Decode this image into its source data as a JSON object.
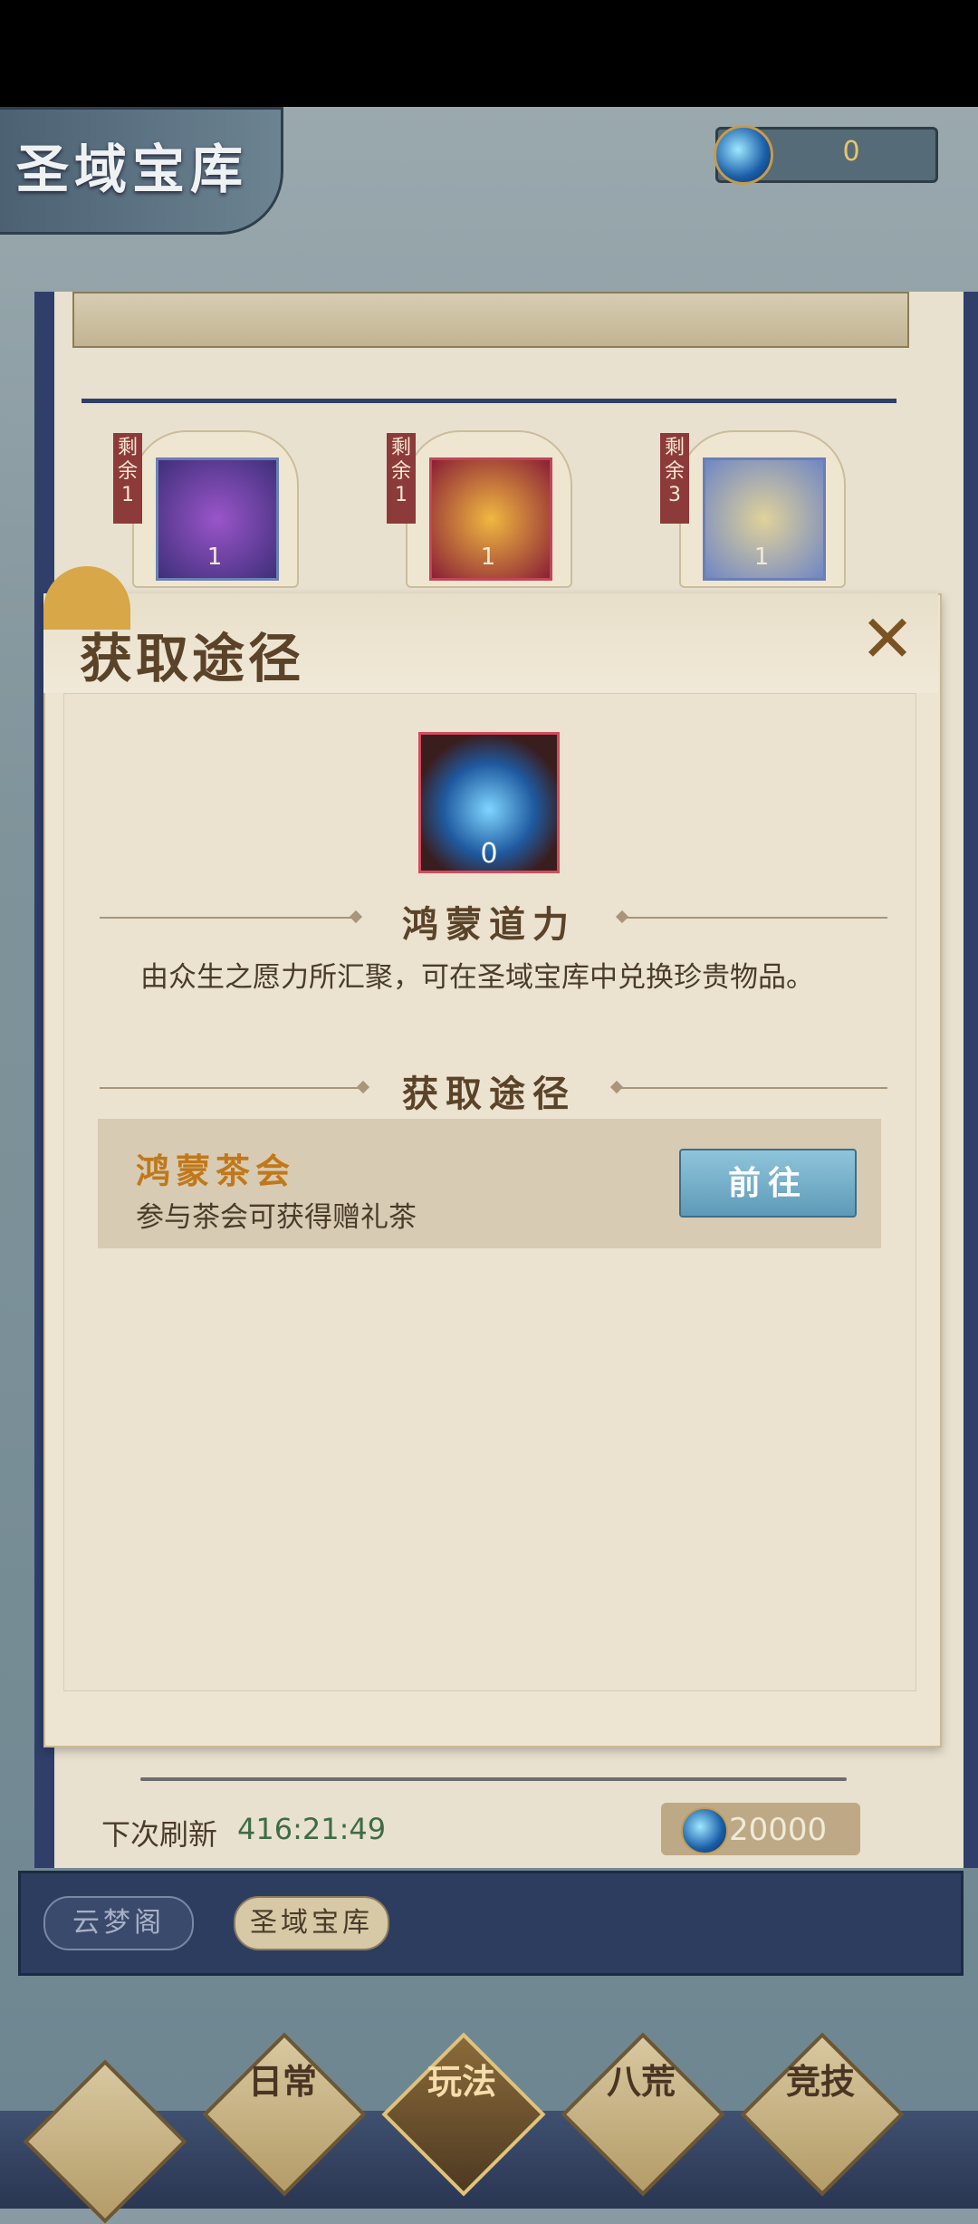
{
  "header": {
    "title": "圣域宝库",
    "currency_value": "0"
  },
  "shop_items": [
    {
      "remaining_label": "剩余",
      "remaining_count": "1",
      "quantity": "1"
    },
    {
      "remaining_label": "剩余",
      "remaining_count": "1",
      "quantity": "1"
    },
    {
      "remaining_label": "剩余",
      "remaining_count": "3",
      "quantity": "1"
    }
  ],
  "modal": {
    "title": "获取途径",
    "item_quantity": "0",
    "item_name": "鸿蒙道力",
    "item_description": "由众生之愿力所汇聚，可在圣域宝库中兑换珍贵物品。",
    "sources_heading": "获取途径",
    "sources": [
      {
        "name": "鸿蒙茶会",
        "description": "参与茶会可获得赠礼茶",
        "button": "前往"
      }
    ],
    "close_icon": "close-icon"
  },
  "footer": {
    "refresh_label": "下次刷新",
    "refresh_time": "416:21:49",
    "price": "20000"
  },
  "tabs": [
    "云梦阁",
    "圣域宝库"
  ],
  "bottom_nav": [
    {
      "label": "日常"
    },
    {
      "label": "玩法"
    },
    {
      "label": "八荒"
    },
    {
      "label": "竞技"
    }
  ],
  "colors": {
    "accent_gold": "#c0781a",
    "panel_blue": "#2c3d60",
    "button_blue": "#5e9ab7"
  }
}
